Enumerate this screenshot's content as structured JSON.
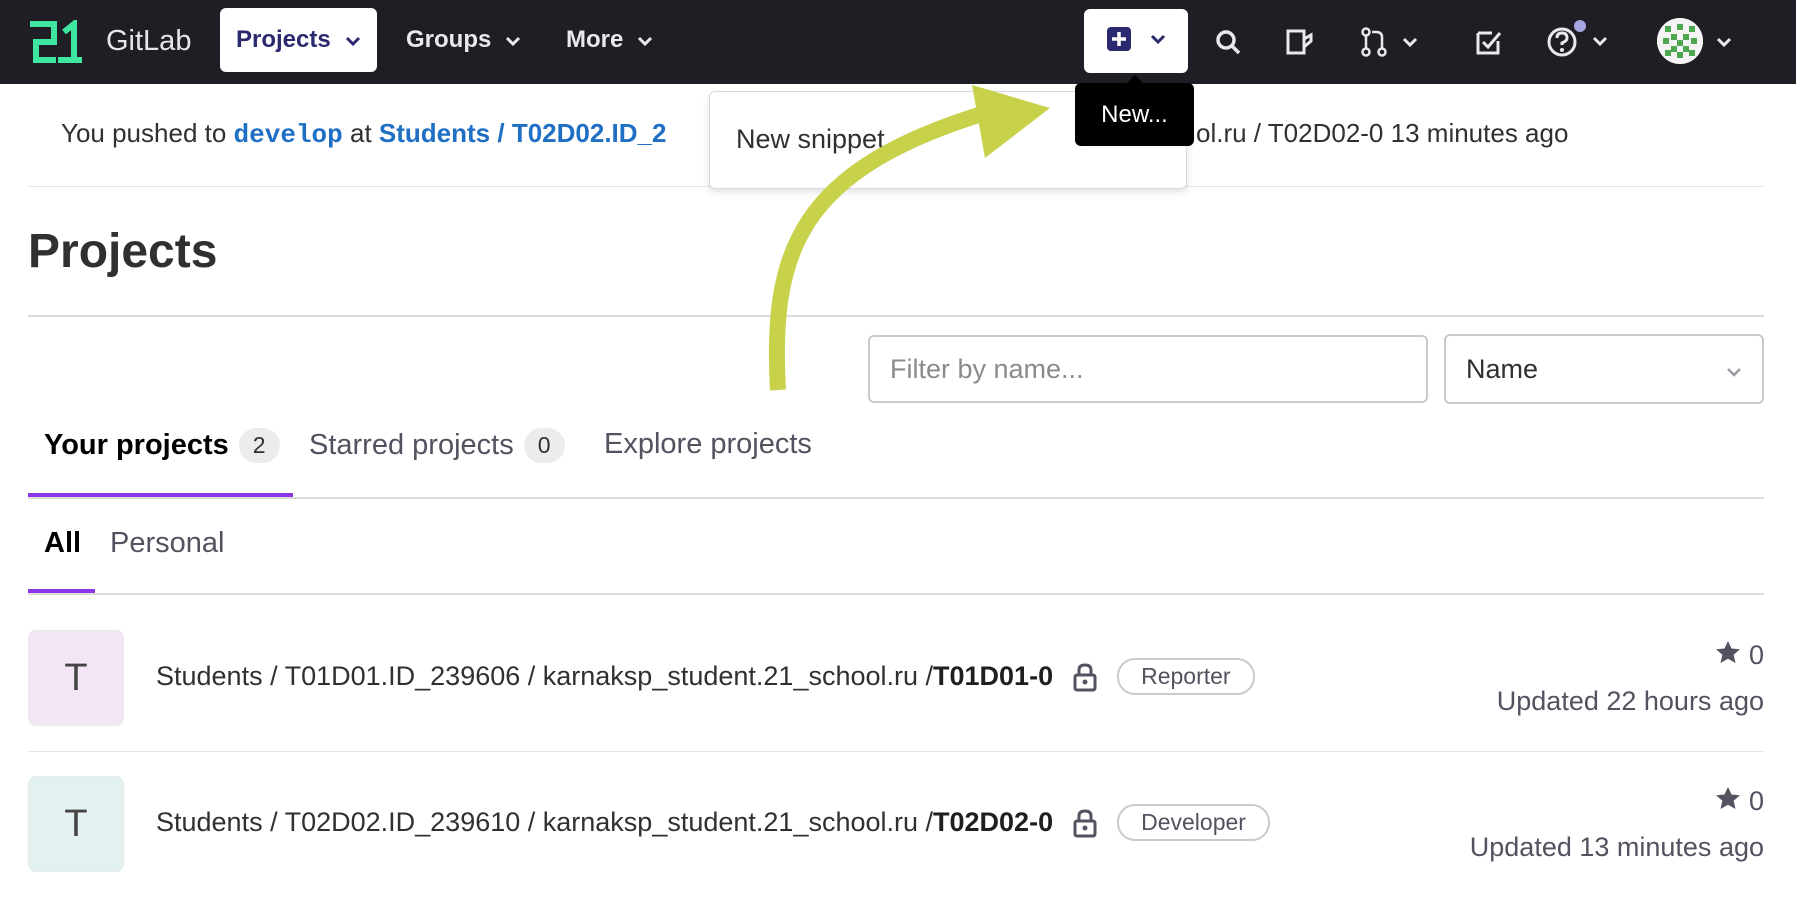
{
  "navbar": {
    "brand": "GitLab",
    "projects_label": "Projects",
    "groups_label": "Groups",
    "more_label": "More"
  },
  "alert": {
    "pushed_prefix": "You pushed to",
    "branch": "develop",
    "at": "at",
    "path_visible_start": "Students / T02D02.ID_2",
    "path_visible_end": "ol.ru / T02D02-0",
    "time": "13 minutes ago"
  },
  "new_dropdown": {
    "item": "New snippet",
    "tooltip": "New..."
  },
  "page": {
    "title": "Projects"
  },
  "filter": {
    "placeholder": "Filter by name...",
    "sort_value": "Name"
  },
  "tabs": [
    {
      "label": "Your projects",
      "count": "2",
      "active": true
    },
    {
      "label": "Starred projects",
      "count": "0",
      "active": false
    },
    {
      "label": "Explore projects",
      "active": false
    }
  ],
  "subtabs": [
    {
      "label": "All",
      "active": true
    },
    {
      "label": "Personal",
      "active": false
    }
  ],
  "projects": [
    {
      "avatar_letter": "T",
      "avatar_color": "#f2e6f4",
      "namespace": "Students / T01D01.ID_239606 / karnaksp_student.21_school.ru / ",
      "name": "T01D01-0",
      "role": "Reporter",
      "stars": "0",
      "updated": "Updated 22 hours ago"
    },
    {
      "avatar_letter": "T",
      "avatar_color": "#e3f1f0",
      "namespace": "Students / T02D02.ID_239610 / karnaksp_student.21_school.ru / ",
      "name": "T02D02-0",
      "role": "Developer",
      "stars": "0",
      "updated": "Updated 13 minutes ago"
    }
  ],
  "colors": {
    "navbar_bg": "#1f1e24",
    "link": "#1f6fc5",
    "tab_underline": "#8a37e6",
    "arrow": "#c8d14a"
  }
}
